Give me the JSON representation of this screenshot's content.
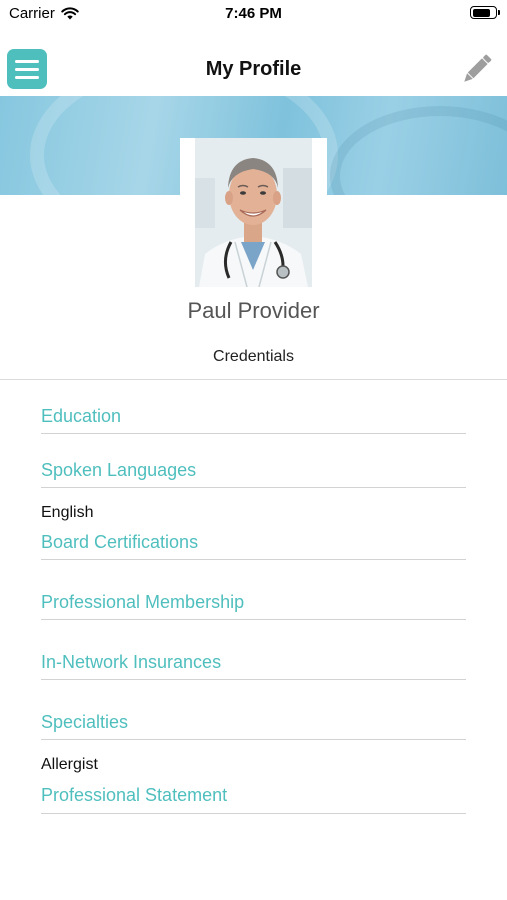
{
  "status_bar": {
    "carrier": "Carrier",
    "time": "7:46 PM",
    "battery_level": 0.8
  },
  "nav": {
    "title": "My Profile",
    "menu_icon": "hamburger-menu-icon",
    "edit_icon": "pencil-icon"
  },
  "colors": {
    "accent": "#4fbfbe",
    "banner": "#86c7df"
  },
  "profile": {
    "name": "Paul Provider",
    "credentials_label": "Credentials"
  },
  "sections": [
    {
      "title": "Education",
      "value": ""
    },
    {
      "title": "Spoken Languages",
      "value": "English"
    },
    {
      "title": "Board Certifications",
      "value": ""
    },
    {
      "title": "Professional Membership",
      "value": ""
    },
    {
      "title": "In-Network Insurances",
      "value": ""
    },
    {
      "title": "Specialties",
      "value": "Allergist"
    },
    {
      "title": "Professional Statement",
      "value": ""
    }
  ]
}
